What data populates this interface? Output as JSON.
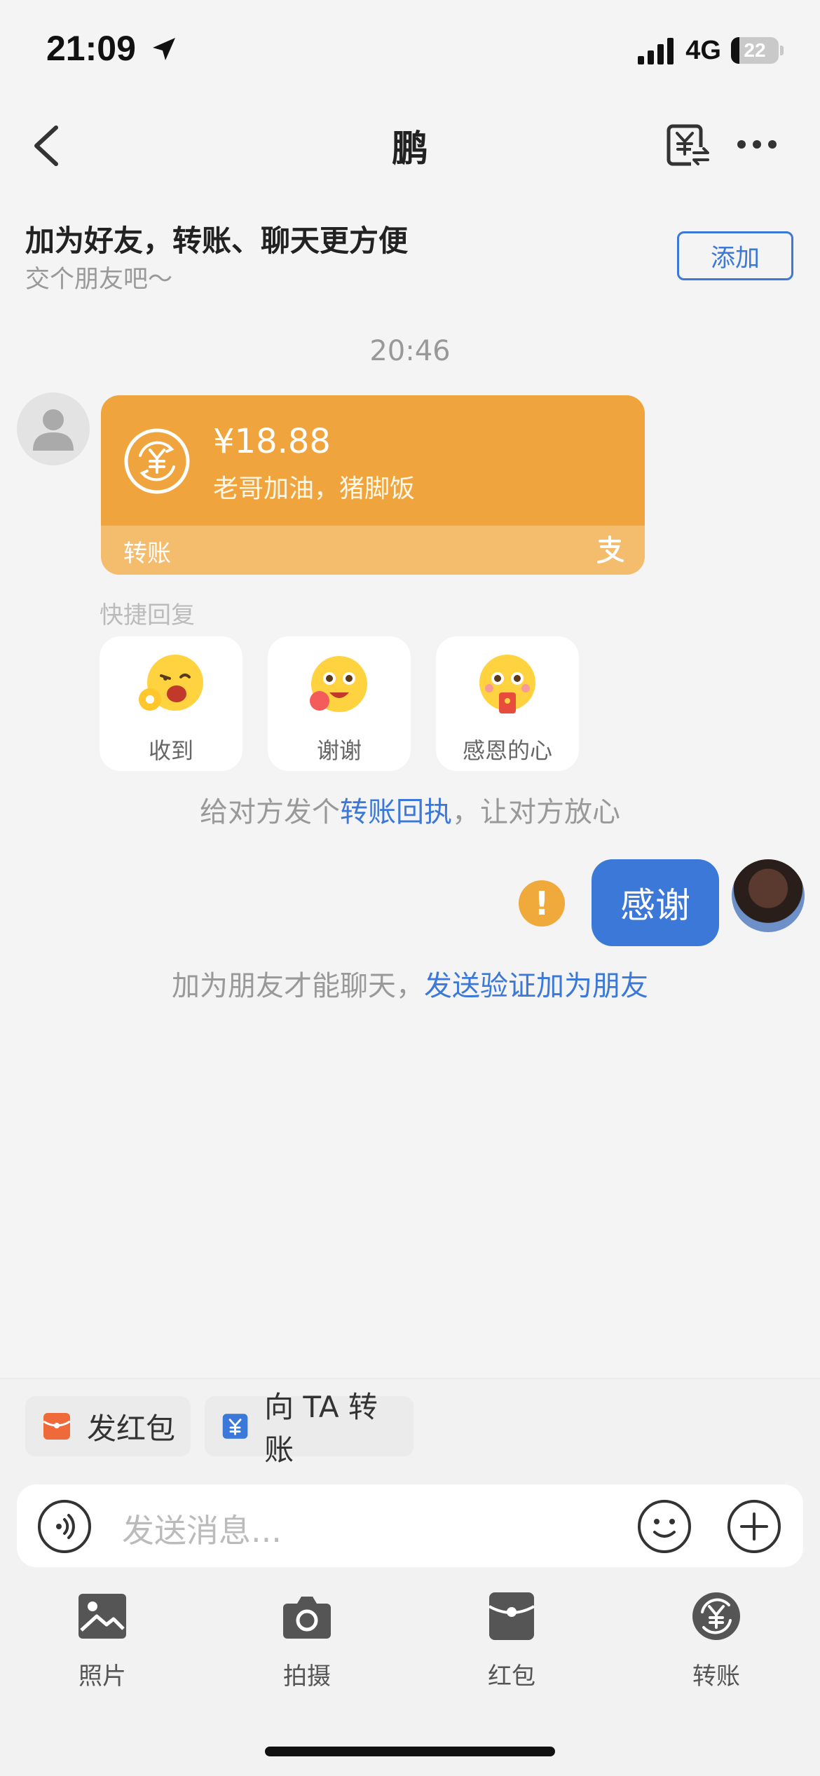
{
  "status_bar": {
    "time": "21:09",
    "network": "4G",
    "battery": "22"
  },
  "nav": {
    "title": "鹏"
  },
  "banner": {
    "title": "加为好友，转账、聊天更方便",
    "subtitle": "交个朋友吧～",
    "add_button": "添加"
  },
  "chat": {
    "timestamp": "20:46",
    "transfer_card": {
      "amount": "¥18.88",
      "memo": "老哥加油，猪脚饭",
      "label": "转账"
    },
    "quick_reply": {
      "label": "快捷回复",
      "items": [
        {
          "label": "收到"
        },
        {
          "label": "谢谢"
        },
        {
          "label": "感恩的心"
        }
      ]
    },
    "receipt_hint": {
      "prefix": "给对方发个",
      "link": "转账回执",
      "suffix": "，让对方放心"
    },
    "my_message": {
      "text": "感谢",
      "warning": "!"
    },
    "friend_hint": {
      "prefix": "加为朋友才能聊天，",
      "link": "发送验证加为朋友"
    }
  },
  "quick_actions": {
    "red_packet": "发红包",
    "transfer": "向 TA 转账"
  },
  "input": {
    "placeholder": "发送消息..."
  },
  "tools": [
    {
      "label": "照片"
    },
    {
      "label": "拍摄"
    },
    {
      "label": "红包"
    },
    {
      "label": "转账"
    }
  ],
  "colors": {
    "accent": "#3b78d8",
    "transfer_card": "#f0a43d",
    "warning": "#f0a93b",
    "red_packet": "#ef6a3a"
  }
}
